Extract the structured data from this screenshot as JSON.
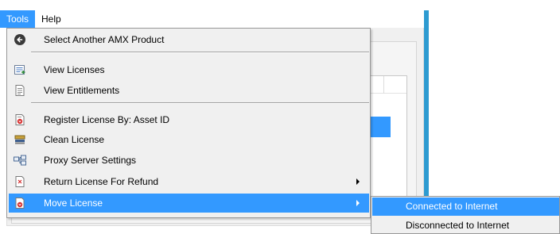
{
  "menubar": {
    "items": [
      {
        "label": "Tools",
        "active": true
      },
      {
        "label": "Help",
        "active": false
      }
    ]
  },
  "tools_menu": {
    "items": [
      {
        "label": "Select Another AMX Product",
        "icon": "back-arrow-icon"
      },
      {
        "label": "View Licenses",
        "icon": "license-list-icon"
      },
      {
        "label": "View Entitlements",
        "icon": "document-icon"
      },
      {
        "label": "Register License By:  Asset ID",
        "icon": "register-license-icon"
      },
      {
        "label": "Clean License",
        "icon": "clean-license-icon"
      },
      {
        "label": "Proxy Server Settings",
        "icon": "network-icon"
      },
      {
        "label": "Return License For Refund",
        "icon": "refund-icon",
        "has_submenu": true
      },
      {
        "label": "Move License",
        "icon": "move-license-icon",
        "has_submenu": true,
        "highlighted": true
      }
    ]
  },
  "move_license_submenu": {
    "items": [
      {
        "label": "Connected to Internet",
        "highlighted": true
      },
      {
        "label": "Disconnected to Internet",
        "highlighted": false
      }
    ]
  },
  "colors": {
    "highlight": "#3399ff",
    "menu_bg": "#f0f0f0",
    "accent_edge": "#2d9bd1"
  }
}
